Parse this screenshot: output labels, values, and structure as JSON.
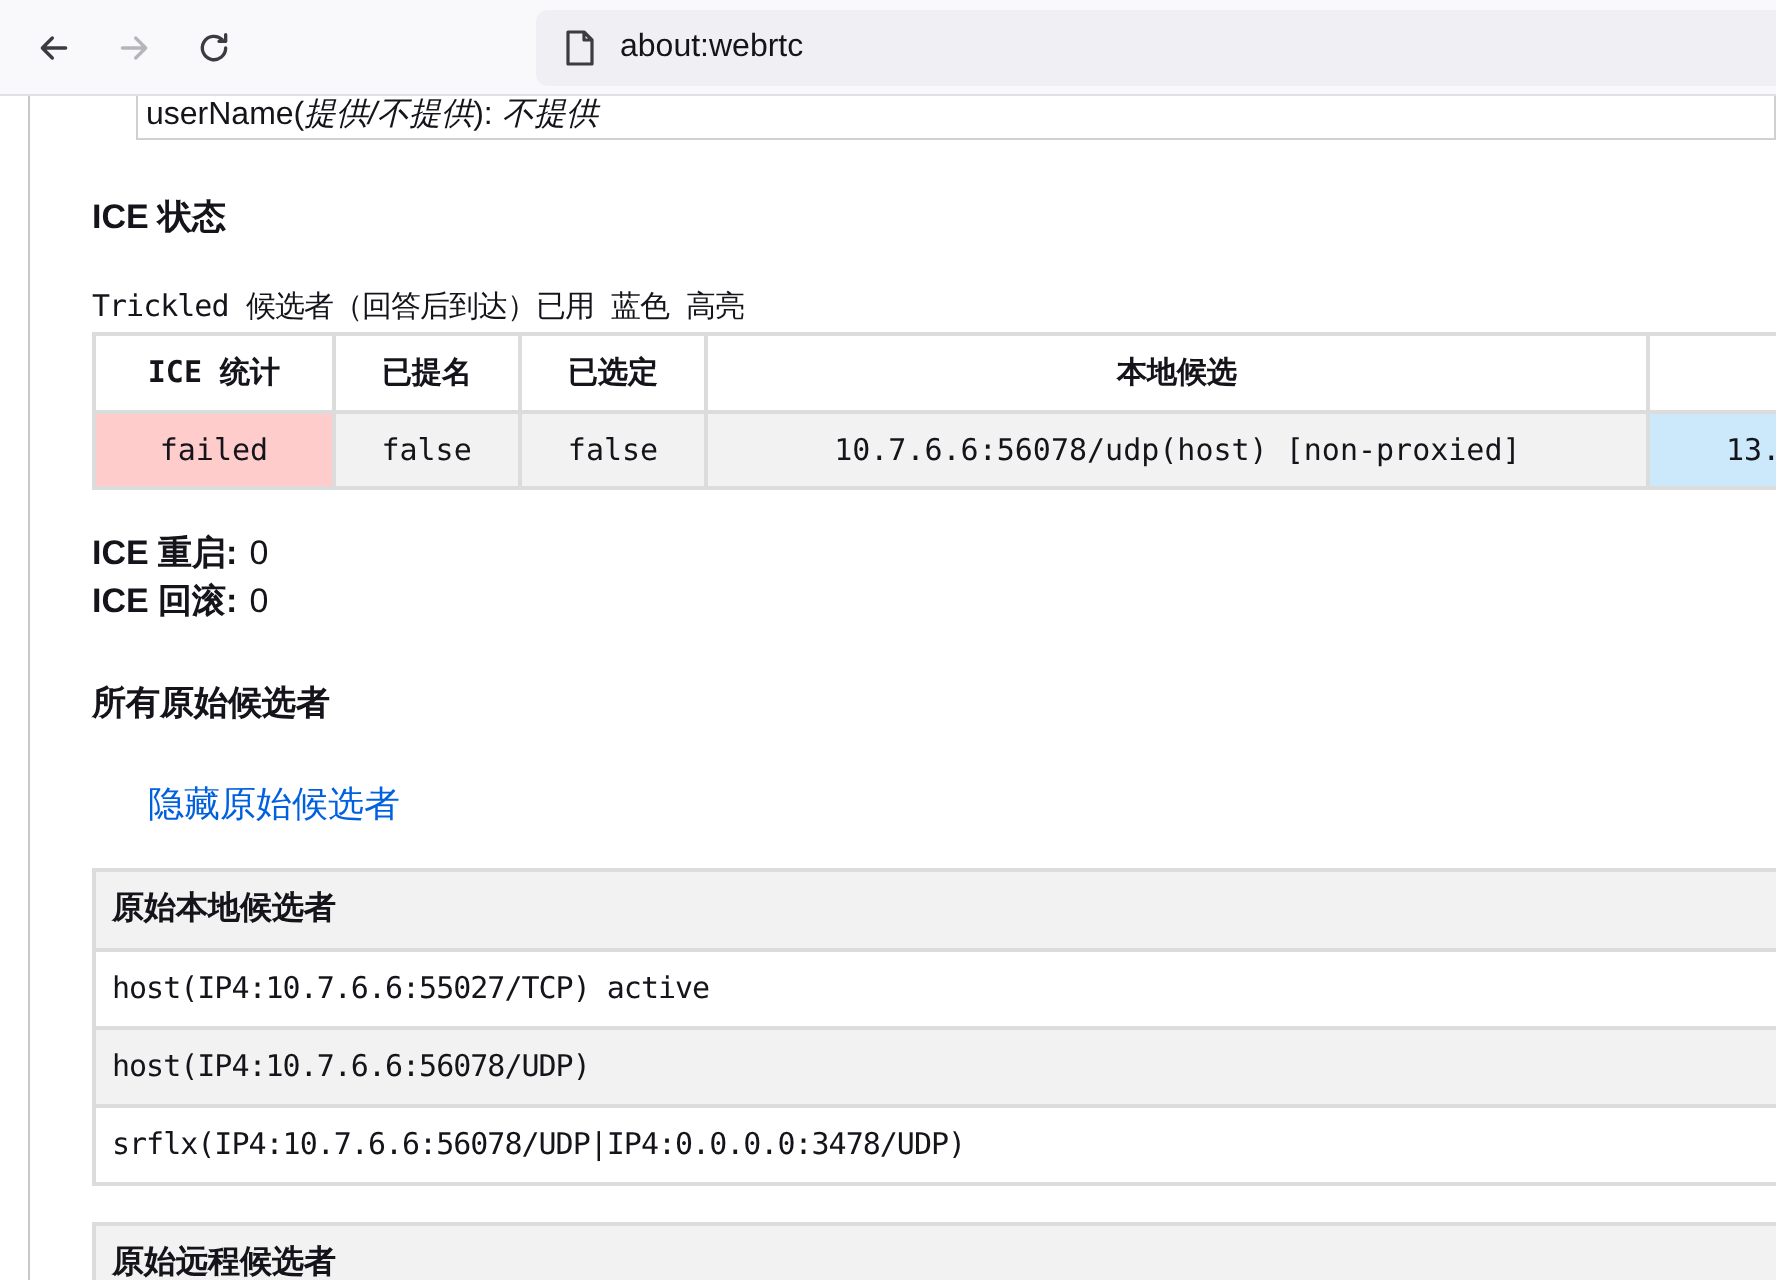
{
  "toolbar": {
    "buttons": [
      {
        "kind": "back",
        "disabled": false
      },
      {
        "kind": "forward",
        "disabled": true
      },
      {
        "kind": "reload",
        "disabled": false
      }
    ],
    "url": "about:webrtc"
  },
  "top_fragment": "userName(*提供/不提供*): *不提供*",
  "ice_state": {
    "heading": "ICE 状态",
    "note": "Trickled 候选者（回答后到达）已用 蓝色 高亮",
    "table": {
      "columns": [
        "ICE 统计",
        "已提名",
        "已选定",
        "本地候选"
      ],
      "rows": [
        {
          "cells": [
            {
              "text": "failed",
              "color": "#ffcccc"
            },
            {
              "text": "false",
              "color": "#f2f2f2"
            },
            {
              "text": "false",
              "color": "#f2f2f2"
            },
            {
              "text": "10.7.6.6:56078/udp(host) [non-proxied]",
              "color": "#f2f2f2"
            },
            {
              "text": "13.",
              "color": "#cce9fb"
            }
          ]
        }
      ]
    }
  },
  "counters": [
    {
      "label": "ICE 重启:",
      "value": "0"
    },
    {
      "label": "ICE 回滚:",
      "value": "0"
    }
  ],
  "raw_candidates": {
    "heading": "所有原始候选者",
    "toggle_link": "隐藏原始候选者",
    "sections": [
      {
        "title": "原始本地候选者",
        "rows": [
          "host(IP4:10.7.6.6:55027/TCP) active",
          "host(IP4:10.7.6.6:56078/UDP)",
          "srflx(IP4:10.7.6.6:56078/UDP|IP4:0.0.0.0:3478/UDP)"
        ]
      },
      {
        "title": "原始远程候选者"
      }
    ]
  }
}
